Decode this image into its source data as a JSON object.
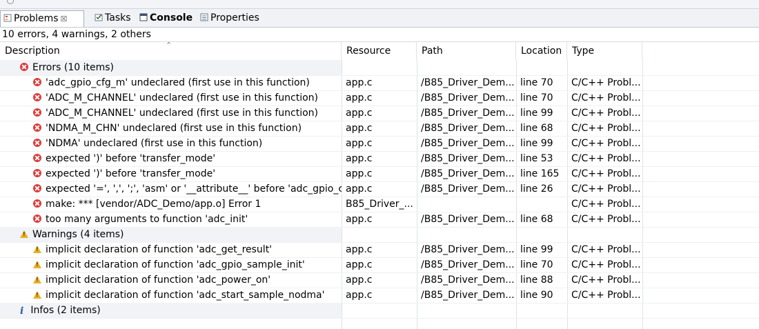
{
  "tabs": [
    {
      "label": "Problems",
      "icon": "problems-icon",
      "close": "☒",
      "active": true
    },
    {
      "label": "Tasks",
      "icon": "tasks-icon",
      "active": false
    },
    {
      "label": "Console",
      "icon": "console-icon",
      "active": false
    },
    {
      "label": "Properties",
      "icon": "properties-icon",
      "active": false
    }
  ],
  "summary": "10 errors, 4 warnings, 2 others",
  "columns": [
    "Description",
    "Resource",
    "Path",
    "Location",
    "Type"
  ],
  "groups": [
    {
      "label": "Errors (10 items)",
      "icon": "error-icon",
      "items": [
        {
          "description": "'adc_gpio_cfg_m' undeclared (first use in this function)",
          "resource": "app.c",
          "path": "/B85_Driver_Dem...",
          "location": "line 70",
          "type": "C/C++ Probl..."
        },
        {
          "description": "'ADC_M_CHANNEL' undeclared (first use in this function)",
          "resource": "app.c",
          "path": "/B85_Driver_Dem...",
          "location": "line 70",
          "type": "C/C++ Probl..."
        },
        {
          "description": "'ADC_M_CHANNEL' undeclared (first use in this function)",
          "resource": "app.c",
          "path": "/B85_Driver_Dem...",
          "location": "line 99",
          "type": "C/C++ Probl..."
        },
        {
          "description": "'NDMA_M_CHN' undeclared (first use in this function)",
          "resource": "app.c",
          "path": "/B85_Driver_Dem...",
          "location": "line 68",
          "type": "C/C++ Probl..."
        },
        {
          "description": "'NDMA' undeclared (first use in this function)",
          "resource": "app.c",
          "path": "/B85_Driver_Dem...",
          "location": "line 99",
          "type": "C/C++ Probl..."
        },
        {
          "description": "expected ')' before 'transfer_mode'",
          "resource": "app.c",
          "path": "/B85_Driver_Dem...",
          "location": "line 53",
          "type": "C/C++ Probl..."
        },
        {
          "description": "expected ')' before 'transfer_mode'",
          "resource": "app.c",
          "path": "/B85_Driver_Dem...",
          "location": "line 165",
          "type": "C/C++ Probl..."
        },
        {
          "description": "expected '=', ',', ';', 'asm' or '__attribute__' before 'adc_gpio_cfg",
          "resource": "app.c",
          "path": "/B85_Driver_Dem...",
          "location": "line 26",
          "type": "C/C++ Probl..."
        },
        {
          "description": "make: *** [vendor/ADC_Demo/app.o] Error 1",
          "resource": "B85_Driver_...",
          "path": "",
          "location": "",
          "type": "C/C++ Probl..."
        },
        {
          "description": "too many arguments to function 'adc_init'",
          "resource": "app.c",
          "path": "/B85_Driver_Dem...",
          "location": "line 68",
          "type": "C/C++ Probl..."
        }
      ]
    },
    {
      "label": "Warnings (4 items)",
      "icon": "warning-icon",
      "items": [
        {
          "description": "implicit declaration of function 'adc_get_result'",
          "resource": "app.c",
          "path": "/B85_Driver_Dem...",
          "location": "line 99",
          "type": "C/C++ Probl..."
        },
        {
          "description": "implicit declaration of function 'adc_gpio_sample_init'",
          "resource": "app.c",
          "path": "/B85_Driver_Dem...",
          "location": "line 70",
          "type": "C/C++ Probl..."
        },
        {
          "description": "implicit declaration of function 'adc_power_on'",
          "resource": "app.c",
          "path": "/B85_Driver_Dem...",
          "location": "line 88",
          "type": "C/C++ Probl..."
        },
        {
          "description": "implicit declaration of function 'adc_start_sample_nodma'",
          "resource": "app.c",
          "path": "/B85_Driver_Dem...",
          "location": "line 90",
          "type": "C/C++ Probl..."
        }
      ]
    },
    {
      "label": "Infos (2 items)",
      "icon": "info-icon",
      "items": []
    }
  ],
  "colors": {
    "error": "#e03b3b",
    "warning": "#e8b026",
    "info": "#2b5cab",
    "group_row_bg": "#f1f3f6"
  }
}
